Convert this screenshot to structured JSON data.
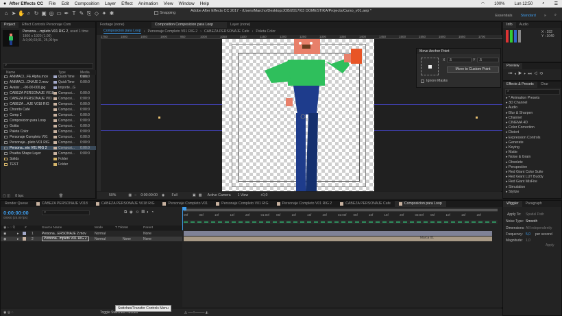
{
  "menubar": {
    "app": "After Effects CC",
    "items": [
      "File",
      "Edit",
      "Composition",
      "Layer",
      "Effect",
      "Animation",
      "View",
      "Window",
      "Help"
    ],
    "right": {
      "battery": "100%",
      "day_time": "Lun 12:50"
    }
  },
  "toolbar": {
    "snapping": "Snapping",
    "path": "Adobe After Effects CC 2017 - /Users/Marcho/Desktop/JOB/2017/03 DOMESTIKA/Projects/Curso_v01.aep *",
    "workspaces": [
      "Essentials",
      "Standard"
    ],
    "active_workspace": "Standard"
  },
  "project": {
    "tabs": [
      "Project",
      "Effect Controls Personaje Com"
    ],
    "selected_name": "Persona....mpleto V01 RIG 2",
    "used": ", used 1 time",
    "size": "1800 x 1920 (1.00)",
    "duration": "Δ 0;00;03;01, 25,00 fps",
    "search_placeholder": "",
    "columns": [
      "Name",
      "Type",
      "Media Dura"
    ],
    "items": [
      {
        "name": "ANIMACI...FE Alpha.mov",
        "type": "QuickTime",
        "dur": "0:00:0",
        "color": "#a2a8c8"
      },
      {
        "name": "ANIMACI...ONAJE 2.mov",
        "type": "QuickTime",
        "dur": "0:00:0",
        "color": "#a2a8c8"
      },
      {
        "name": "Avatar ...-00-00-000.jpg",
        "type": "Importe...G",
        "dur": "",
        "color": "#a2a8c8"
      },
      {
        "name": "CABEZA PERSONAJE V018",
        "type": "Composi...",
        "dur": "0:00:0",
        "color": "#c8b2a0"
      },
      {
        "name": "CABEZA PERSONAJE V01",
        "type": "Composi...",
        "dur": "0:00:0",
        "color": "#c8b2a0"
      },
      {
        "name": "CABEZA ...AJE V018 RIG",
        "type": "Composi...",
        "dur": "0:00:0",
        "color": "#c8b2a0"
      },
      {
        "name": "Chorrito Café",
        "type": "Composi...",
        "dur": "0:00:0",
        "color": "#c8b2a0"
      },
      {
        "name": "Comp 2",
        "type": "Composi...",
        "dur": "0:00:0",
        "color": "#c8b2a0"
      },
      {
        "name": "Composicion para Loop",
        "type": "Composi...",
        "dur": "0:00:0",
        "color": "#c8b2a0"
      },
      {
        "name": "Gotita",
        "type": "Composi...",
        "dur": "0:00:0",
        "color": "#c8b2a0"
      },
      {
        "name": "Paleta Color",
        "type": "Composi...",
        "dur": "0:00:0",
        "color": "#c8b2a0"
      },
      {
        "name": "Personaje Completo V01",
        "type": "Composi...",
        "dur": "0:00:0",
        "color": "#c8b2a0"
      },
      {
        "name": "Personaje...pleto V01 RIG",
        "type": "Composi...",
        "dur": "0:00:0",
        "color": "#c8b2a0"
      },
      {
        "name": "Persona...eto V01 RIG 2",
        "type": "Composi...",
        "dur": "0:00:0",
        "color": "#c8b2a0",
        "selected": true
      },
      {
        "name": "Prueba Shape Layer",
        "type": "Composi...",
        "dur": "0:00:0",
        "color": "#c8b2a0"
      },
      {
        "name": "Solids",
        "type": "Folder",
        "dur": "",
        "color": "#d4b46a",
        "folder": true
      },
      {
        "name": "TEST",
        "type": "Folder",
        "dur": "",
        "color": "#d4b46a",
        "folder": true
      }
    ],
    "footer": "8 bpc"
  },
  "viewer": {
    "tabs": [
      "Footage (none)",
      "Composition Composicion para Loop",
      "Layer (none)"
    ],
    "subtabs": [
      "Composicion para Loop",
      "Personaje Completo V01 RIG 2",
      "CABEZA PERSONAJE Cafe",
      "Paleta Color"
    ],
    "ruler": [
      "1750",
      "1800",
      "1850",
      "1900",
      "950",
      "1000",
      "1050",
      "1100",
      "1150",
      "1200",
      "1250",
      "1300",
      "1350",
      "1400",
      "1450",
      "1500",
      "1550",
      "1600",
      "1650",
      "1700"
    ],
    "zoom": "50%",
    "time": "0:00:00:00",
    "quality": "Full",
    "camera": "Active Camera",
    "views": "1 View",
    "exposure": "+0,0",
    "anchor_panel": {
      "title": "Move Anchor Point",
      "x_label": "X",
      "x_val": ".5",
      "y_label": "Y",
      "y_val": ".5",
      "button": "Move to Custom Point",
      "ignore_masks": "Ignore Masks"
    }
  },
  "info": {
    "tabs": [
      "Info",
      "Audio"
    ],
    "x": "X : 192",
    "y": "Y : 1040"
  },
  "preview": {
    "title": "Preview"
  },
  "effects": {
    "tabs": [
      "Effects & Presets",
      "Char"
    ],
    "search_placeholder": "",
    "items": [
      "* Animation Presets",
      "3D Channel",
      "Audio",
      "Blur & Sharpen",
      "Channel",
      "CINEMA 4D",
      "Color Correction",
      "Distort",
      "Expression Controls",
      "Generate",
      "Keying",
      "Matte",
      "Noise & Grain",
      "Obsolete",
      "Perspective",
      "Red Giant Color Suite",
      "Red Giant LUT Buddy",
      "Red Giant MisFire",
      "Simulation",
      "Stylize"
    ]
  },
  "timeline": {
    "tabs": [
      {
        "label": "Render Queue",
        "color": ""
      },
      {
        "label": "CABEZA PERSONAJE V018",
        "color": "#c8b2a0"
      },
      {
        "label": "CABEZA PERSONAJE V018 RIG",
        "color": "#c8b2a0"
      },
      {
        "label": "Personaje Completo V01",
        "color": "#c8b2a0"
      },
      {
        "label": "Personaje Completo V01 RIG",
        "color": "#c8b2a0"
      },
      {
        "label": "Personaje Completo V01 RIG 2",
        "color": "#c8b2a0"
      },
      {
        "label": "CABEZA PERSONAJE Cafe",
        "color": "#c8b2a0"
      },
      {
        "label": "Composicion para Loop",
        "color": "#c8b2a0"
      }
    ],
    "active_tab": "Composicion para Loop",
    "timecode": "0:00:00:00",
    "frames": "00000 (25.00 fps)",
    "columns": [
      "Source Name",
      "Mode",
      "T TrkMat",
      "Parent"
    ],
    "layers": [
      {
        "num": "1",
        "name": "Persona...ERSONAJE 2.mov",
        "mode": "Normal",
        "trk": "",
        "parent": "None"
      },
      {
        "num": "2",
        "name": "Persona...mpleto V01 RIG 2",
        "mode": "Normal",
        "trk": "None",
        "parent": "None"
      }
    ],
    "ruler": [
      "00f",
      "05f",
      "10f",
      "15f",
      "20f",
      "01:00f",
      "05f",
      "10f",
      "15f",
      "20f",
      "02:00f",
      "05f",
      "10f",
      "15f",
      "20f",
      "03:00f",
      "05f",
      "10f",
      "15f",
      "20f"
    ],
    "marker": "Marca 01",
    "toggle_label": "Toggle Switches / Modes",
    "tooltip": "Switches/Transfer Controls Menu"
  },
  "wiggler": {
    "tabs": [
      "Wiggler",
      "Paragraph"
    ],
    "apply_to_label": "Apply To:",
    "apply_to": "Spatial Path",
    "noise_label": "Noise Type:",
    "noise": "Smooth",
    "dimensions_label": "Dimensions:",
    "dimensions": "All Independently",
    "freq_label": "Frequency:",
    "freq": "5,0",
    "freq_unit": "per second",
    "mag_label": "Magnitude:",
    "mag": "1,0",
    "apply": "Apply"
  }
}
